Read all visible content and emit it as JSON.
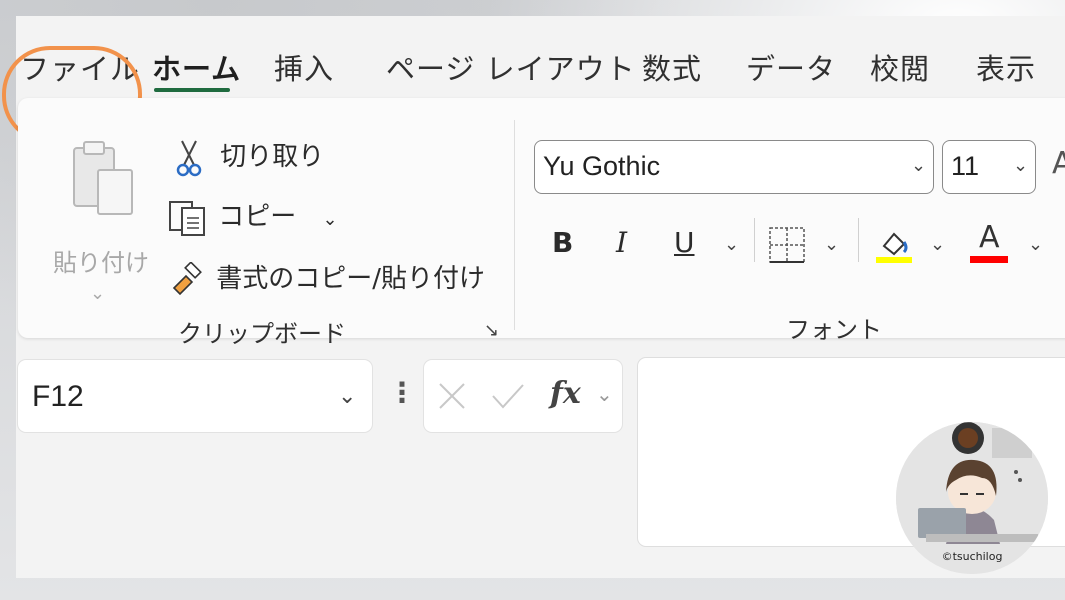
{
  "tabs": [
    {
      "label": "ファイル"
    },
    {
      "label": "ホーム"
    },
    {
      "label": "挿入"
    },
    {
      "label": "ページ レイアウト"
    },
    {
      "label": "数式"
    },
    {
      "label": "データ"
    },
    {
      "label": "校閲"
    },
    {
      "label": "表示"
    }
  ],
  "clipboard": {
    "paste_label": "貼り付け",
    "cut_label": "切り取り",
    "copy_label": "コピー",
    "format_painter_label": "書式のコピー/貼り付け",
    "group_label": "クリップボード"
  },
  "font": {
    "font_name": "Yu Gothic",
    "font_size": "11",
    "bold": "B",
    "italic": "I",
    "underline": "U",
    "font_color_glyph": "A",
    "group_label": "フォント",
    "fill_color": "#ffff00",
    "text_color": "#ff0000"
  },
  "formula_bar": {
    "name_box": "F12",
    "fx_label": "fx"
  },
  "logo": {
    "text": "©tsuchilog"
  },
  "colors": {
    "accent": "#1f6b3f",
    "highlight": "#f2924b"
  }
}
